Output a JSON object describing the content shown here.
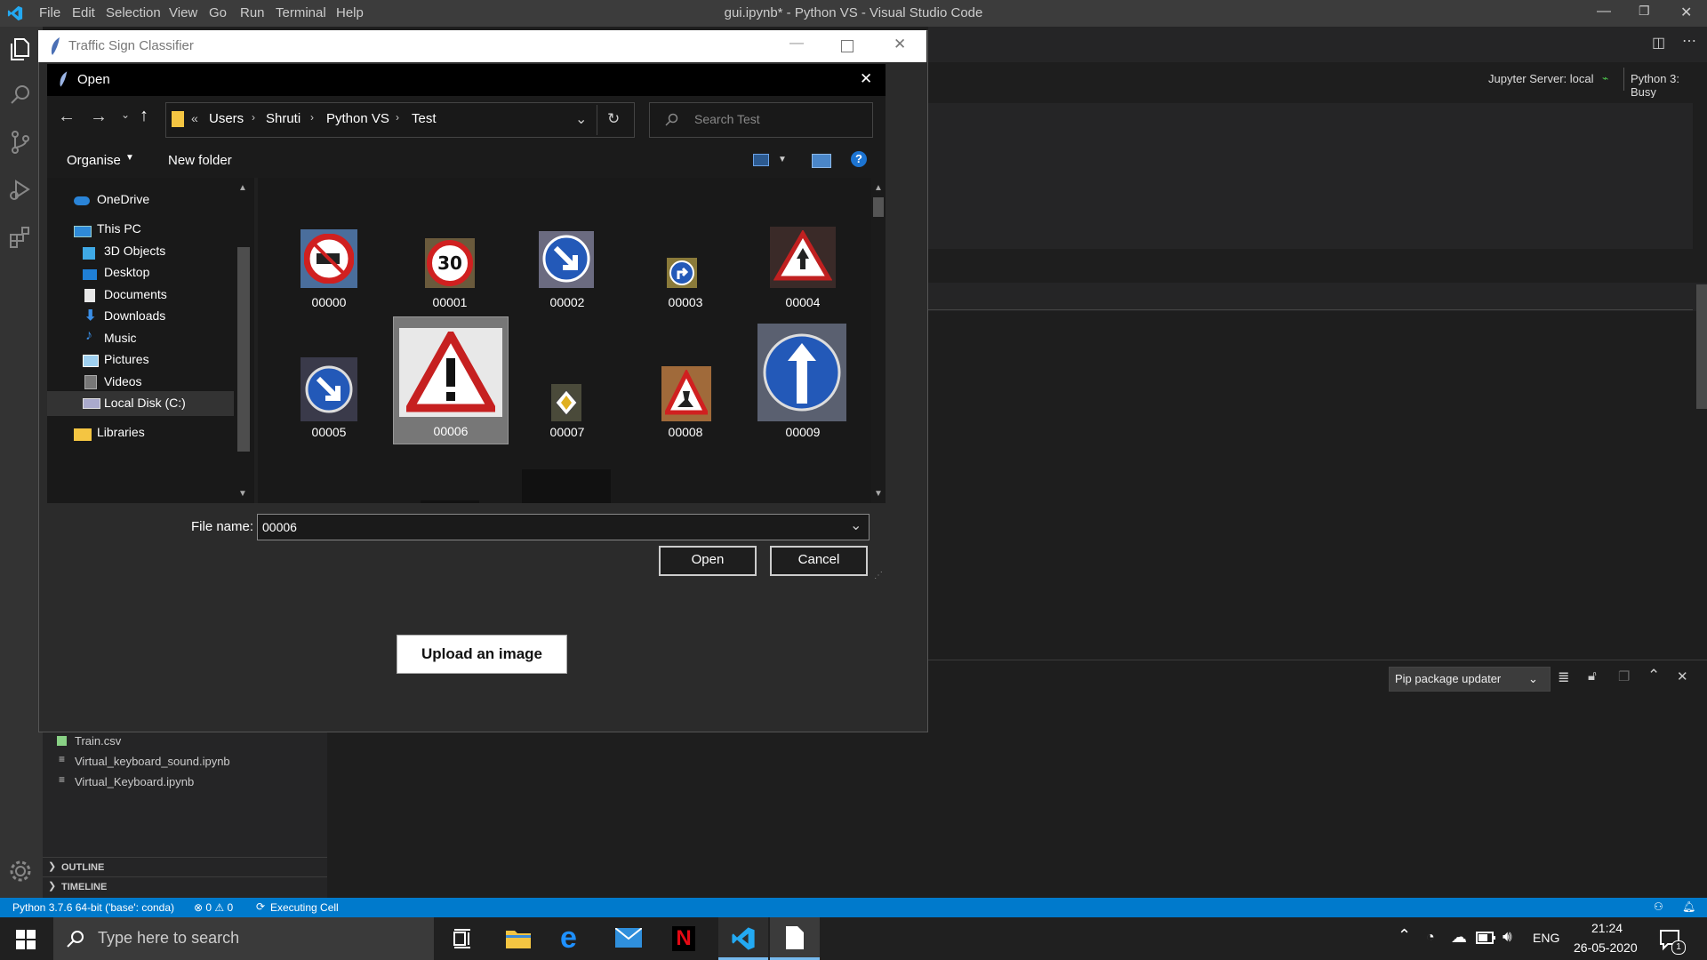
{
  "vscode": {
    "menu": [
      "File",
      "Edit",
      "Selection",
      "View",
      "Go",
      "Run",
      "Terminal",
      "Help"
    ],
    "window_title": "gui.ipynb* - Python VS - Visual Studio Code",
    "jupyter_server": "Jupyter Server: local",
    "kernel_status": "Python 3: Busy",
    "panel_dropdown": "Pip package updater",
    "explorer_files": [
      "Train.csv",
      "Virtual_keyboard_sound.ipynb",
      "Virtual_Keyboard.ipynb"
    ],
    "sections": [
      "OUTLINE",
      "TIMELINE"
    ],
    "status": {
      "interpreter": "Python 3.7.6 64-bit ('base': conda)",
      "problems": "⊗ 0 ⚠ 0",
      "executing": "Executing Cell"
    }
  },
  "app_window": {
    "title": "Traffic Sign Classifier",
    "upload_button": "Upload an image"
  },
  "dialog": {
    "title": "Open",
    "breadcrumb": [
      "Users",
      "Shruti",
      "Python VS",
      "Test"
    ],
    "search_placeholder": "Search Test",
    "organise": "Organise",
    "new_folder": "New folder",
    "nav_items": [
      "OneDrive",
      "This PC",
      "3D Objects",
      "Desktop",
      "Documents",
      "Downloads",
      "Music",
      "Pictures",
      "Videos",
      "Local Disk (C:)",
      "Libraries"
    ],
    "files": [
      "00000",
      "00001",
      "00002",
      "00003",
      "00004",
      "00005",
      "00006",
      "00007",
      "00008",
      "00009"
    ],
    "selected_file": "00006",
    "file_name_label": "File name:",
    "file_name_value": "00006",
    "open_button": "Open",
    "cancel_button": "Cancel"
  },
  "taskbar": {
    "search_placeholder": "Type here to search",
    "language": "ENG",
    "time": "21:24",
    "date": "26-05-2020",
    "notification_count": "1"
  },
  "colors": {
    "status_bar": "#007acc",
    "accent": "#0078d7"
  }
}
